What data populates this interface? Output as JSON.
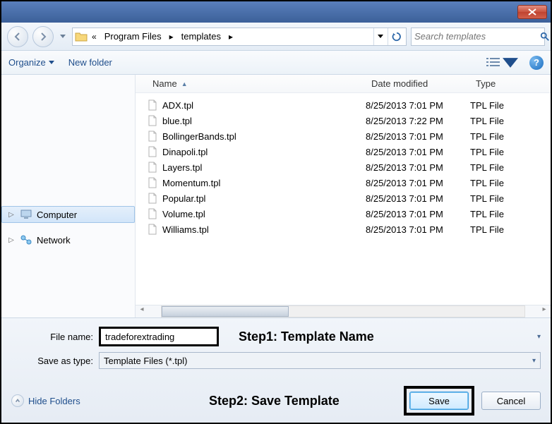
{
  "breadcrumb": {
    "level1": "Program Files",
    "level2": "templates"
  },
  "search": {
    "placeholder": "Search templates"
  },
  "toolbar": {
    "organize": "Organize",
    "new_folder": "New folder",
    "help": "?"
  },
  "sidebar": {
    "computer": "Computer",
    "network": "Network"
  },
  "columns": {
    "name": "Name",
    "date": "Date modified",
    "type": "Type"
  },
  "files": [
    {
      "name": "ADX.tpl",
      "date": "8/25/2013 7:01 PM",
      "type": "TPL File"
    },
    {
      "name": "blue.tpl",
      "date": "8/25/2013 7:22 PM",
      "type": "TPL File"
    },
    {
      "name": "BollingerBands.tpl",
      "date": "8/25/2013 7:01 PM",
      "type": "TPL File"
    },
    {
      "name": "Dinapoli.tpl",
      "date": "8/25/2013 7:01 PM",
      "type": "TPL File"
    },
    {
      "name": "Layers.tpl",
      "date": "8/25/2013 7:01 PM",
      "type": "TPL File"
    },
    {
      "name": "Momentum.tpl",
      "date": "8/25/2013 7:01 PM",
      "type": "TPL File"
    },
    {
      "name": "Popular.tpl",
      "date": "8/25/2013 7:01 PM",
      "type": "TPL File"
    },
    {
      "name": "Volume.tpl",
      "date": "8/25/2013 7:01 PM",
      "type": "TPL File"
    },
    {
      "name": "Williams.tpl",
      "date": "8/25/2013 7:01 PM",
      "type": "TPL File"
    }
  ],
  "form": {
    "file_name_label": "File name:",
    "file_name_value": "tradeforextrading",
    "save_type_label": "Save as type:",
    "save_type_value": "Template Files (*.tpl)"
  },
  "annotations": {
    "step1": "Step1: Template Name",
    "step2": "Step2: Save Template"
  },
  "actions": {
    "hide": "Hide Folders",
    "save": "Save",
    "cancel": "Cancel"
  }
}
